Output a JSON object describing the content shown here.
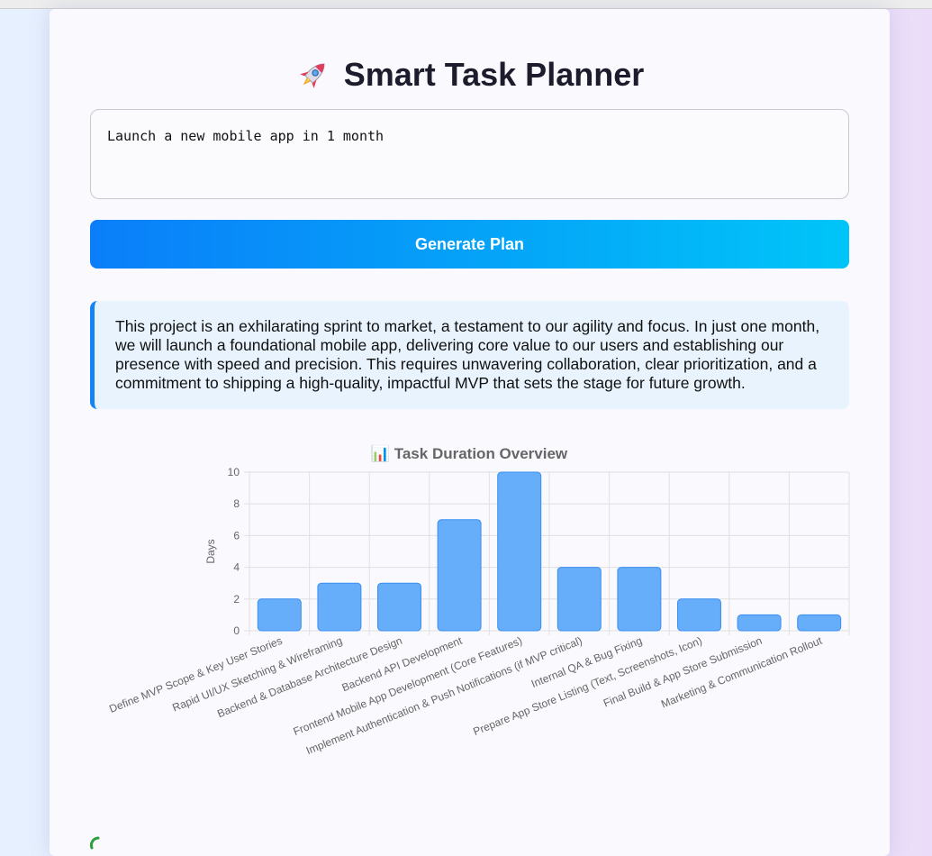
{
  "app": {
    "title": "Smart Task Planner",
    "goal_input_value": "Launch a new mobile app in 1 month",
    "generate_button_label": "Generate Plan",
    "summary": "This project is an exhilarating sprint to market, a testament to our agility and focus. In just one month, we will launch a foundational mobile app, delivering core value to our users and establishing our presence with speed and precision. This requires unwavering collaboration, clear prioritization, and a commitment to shipping a high-quality, impactful MVP that sets the stage for future growth."
  },
  "colors": {
    "accent": "#1483f5",
    "button_gradient_start": "#0a7ef9",
    "button_gradient_end": "#00c5f8",
    "bar_fill": "#66adfa",
    "bar_stroke": "#3a8ff0"
  },
  "chart_data": {
    "type": "bar",
    "title": "📊 Task Duration Overview",
    "xlabel": "",
    "ylabel": "Days",
    "ylim": [
      0,
      10
    ],
    "yticks": [
      0,
      2,
      4,
      6,
      8,
      10
    ],
    "grid": true,
    "categories": [
      "Define MVP Scope & Key User Stories",
      "Rapid UI/UX Sketching & Wireframing",
      "Backend & Database Architecture Design",
      "Backend API Development",
      "Frontend Mobile App Development (Core Features)",
      "Implement Authentication & Push Notifications (if MVP critical)",
      "Internal QA & Bug Fixing",
      "Prepare App Store Listing (Text, Screenshots, Icon)",
      "Final Build & App Store Submission",
      "Marketing & Communication Rollout"
    ],
    "values": [
      2,
      3,
      3,
      7,
      10,
      4,
      4,
      2,
      1,
      1
    ]
  }
}
